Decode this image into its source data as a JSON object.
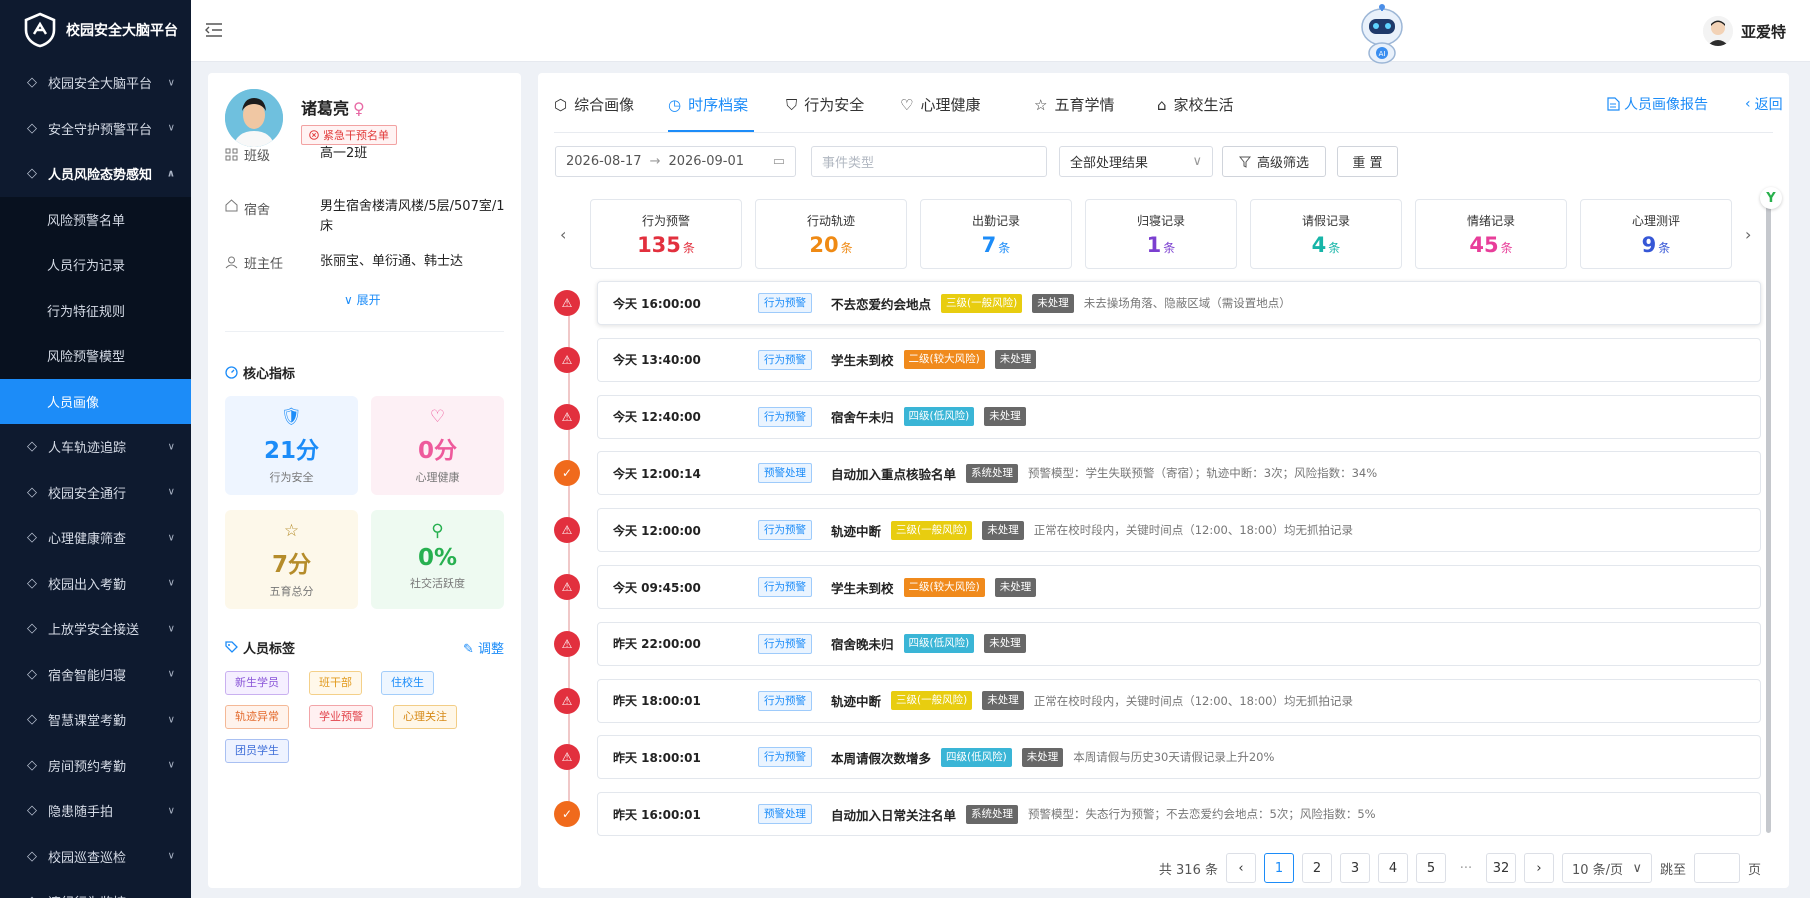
{
  "app": {
    "title": "校园安全大脑平台"
  },
  "sidebar": {
    "items": [
      {
        "label": "校园安全大脑平台",
        "icon": "shield-star-icon"
      },
      {
        "label": "安全守护预警平台",
        "icon": "alarm-icon"
      },
      {
        "label": "人员风险态势感知",
        "icon": "shield-check-icon",
        "open": true,
        "children": [
          {
            "label": "风险预警名单"
          },
          {
            "label": "人员行为记录"
          },
          {
            "label": "行为特征规则"
          },
          {
            "label": "风险预警模型"
          },
          {
            "label": "人员画像",
            "active": true
          }
        ]
      },
      {
        "label": "人车轨迹追踪",
        "icon": "location-icon"
      },
      {
        "label": "校园安全通行",
        "icon": "gate-icon"
      },
      {
        "label": "心理健康筛查",
        "icon": "heart-icon"
      },
      {
        "label": "校园出入考勤",
        "icon": "clipboard-icon"
      },
      {
        "label": "上放学安全接送",
        "icon": "users-icon"
      },
      {
        "label": "宿舍智能归寝",
        "icon": "building-icon"
      },
      {
        "label": "智慧课堂考勤",
        "icon": "classroom-icon"
      },
      {
        "label": "房间预约考勤",
        "icon": "calendar-icon"
      },
      {
        "label": "隐患随手拍",
        "icon": "camera-icon"
      },
      {
        "label": "校园巡查巡检",
        "icon": "patrol-icon"
      },
      {
        "label": "违纪行为监控",
        "icon": "monitor-icon"
      }
    ]
  },
  "header": {
    "user_name": "亚爱特"
  },
  "profile": {
    "name": "诸葛亮",
    "gender_symbol": "♀",
    "tag": "紧急干预名单",
    "class_label": "班级",
    "class_value": "高一2班",
    "dorm_label": "宿舍",
    "dorm_value": "男生宿舍楼清风楼/5层/507室/1床",
    "teacher_label": "班主任",
    "teacher_value": "张丽宝、单衍通、韩士达",
    "expand": "展开",
    "metrics_title": "核心指标",
    "metrics": [
      {
        "value": "21分",
        "label": "行为安全",
        "color": "#1c8cf8",
        "bg": "#eef5ff"
      },
      {
        "value": "0分",
        "label": "心理健康",
        "color": "#ee5a9c",
        "bg": "#fdf0f5"
      },
      {
        "value": "7分",
        "label": "五育总分",
        "color": "#b58c2a",
        "bg": "#fdf8ea"
      },
      {
        "value": "0%",
        "label": "社交活跃度",
        "color": "#27b050",
        "bg": "#eefaf1"
      }
    ],
    "tags_title": "人员标签",
    "adjust": "调整",
    "tags": [
      {
        "label": "新生学员",
        "color": "#8a56d8",
        "bg": "#f5efff",
        "border": "#c9b0f0"
      },
      {
        "label": "班干部",
        "color": "#e19a1d",
        "bg": "#fff8ea",
        "border": "#f4d089"
      },
      {
        "label": "住校生",
        "color": "#1c8cf8",
        "bg": "#eef6ff",
        "border": "#a3cdfa"
      },
      {
        "label": "轨迹异常",
        "color": "#e36a2c",
        "bg": "#fff3ec",
        "border": "#f4b896"
      },
      {
        "label": "学业预警",
        "color": "#e2434b",
        "bg": "#fff0f1",
        "border": "#f2a4a8"
      },
      {
        "label": "心理关注",
        "color": "#d68a18",
        "bg": "#fff7e8",
        "border": "#f2cd86"
      },
      {
        "label": "团员学生",
        "color": "#3f6fd8",
        "bg": "#eef3ff",
        "border": "#a9c0f2"
      }
    ]
  },
  "tabs": [
    {
      "label": "综合画像",
      "icon": "radar-icon"
    },
    {
      "label": "时序档案",
      "icon": "clock-icon",
      "active": true
    },
    {
      "label": "行为安全",
      "icon": "shield-icon"
    },
    {
      "label": "心理健康",
      "icon": "heart-icon"
    },
    {
      "label": "五育学情",
      "icon": "star-icon"
    },
    {
      "label": "家校生活",
      "icon": "home-icon"
    }
  ],
  "actions": {
    "report": "人员画像报告",
    "back": "返回"
  },
  "filters": {
    "date_start": "2026-08-17",
    "date_end": "2026-09-01",
    "event_type_placeholder": "事件类型",
    "result_select": "全部处理结果",
    "advanced": "高级筛选",
    "reset": "重 置"
  },
  "stats": [
    {
      "label": "行为预警",
      "value": "135",
      "unit": "条",
      "color": "#e2303e"
    },
    {
      "label": "行动轨迹",
      "value": "20",
      "unit": "条",
      "color": "#ef8a14"
    },
    {
      "label": "出勤记录",
      "value": "7",
      "unit": "条",
      "color": "#1c8cf8"
    },
    {
      "label": "归寝记录",
      "value": "1",
      "unit": "条",
      "color": "#7b3fd0"
    },
    {
      "label": "请假记录",
      "value": "4",
      "unit": "条",
      "color": "#17b5a8"
    },
    {
      "label": "情绪记录",
      "value": "45",
      "unit": "条",
      "color": "#e83e9a"
    },
    {
      "label": "心理测评",
      "value": "9",
      "unit": "条",
      "color": "#3657d6"
    }
  ],
  "events": [
    {
      "time": "今天 16:00:00",
      "type": "行为预警",
      "title": "不去恋爱约会地点",
      "level": "三级(一般风险)",
      "level_color": "#e8cd10",
      "status": "未处理",
      "desc": "未去操场角落、隐蔽区域（需设置地点）",
      "kind": "warn"
    },
    {
      "time": "今天 13:40:00",
      "type": "行为预警",
      "title": "学生未到校",
      "level": "二级(较大风险)",
      "level_color": "#f08a1c",
      "status": "未处理",
      "desc": "",
      "kind": "warn"
    },
    {
      "time": "今天 12:40:00",
      "type": "行为预警",
      "title": "宿舍午未归",
      "level": "四级(低风险)",
      "level_color": "#3ab5d6",
      "status": "未处理",
      "desc": "",
      "kind": "warn"
    },
    {
      "time": "今天 12:00:14",
      "type": "预警处理",
      "title": "自动加入重点核验名单",
      "level": "",
      "level_color": "",
      "status": "系统处理",
      "desc": "预警模型：学生失联预警（寄宿）；轨迹中断：3次；风险指数：34%",
      "kind": "handle"
    },
    {
      "time": "今天 12:00:00",
      "type": "行为预警",
      "title": "轨迹中断",
      "level": "三级(一般风险)",
      "level_color": "#e8cd10",
      "status": "未处理",
      "desc": "正常在校时段内，关键时间点（12:00、18:00）均无抓拍记录",
      "kind": "warn"
    },
    {
      "time": "今天 09:45:00",
      "type": "行为预警",
      "title": "学生未到校",
      "level": "二级(较大风险)",
      "level_color": "#f08a1c",
      "status": "未处理",
      "desc": "",
      "kind": "warn"
    },
    {
      "time": "昨天 22:00:00",
      "type": "行为预警",
      "title": "宿舍晚未归",
      "level": "四级(低风险)",
      "level_color": "#3ab5d6",
      "status": "未处理",
      "desc": "",
      "kind": "warn"
    },
    {
      "time": "昨天 18:00:01",
      "type": "行为预警",
      "title": "轨迹中断",
      "level": "三级(一般风险)",
      "level_color": "#e8cd10",
      "status": "未处理",
      "desc": "正常在校时段内，关键时间点（12:00、18:00）均无抓拍记录",
      "kind": "warn"
    },
    {
      "time": "昨天 18:00:01",
      "type": "行为预警",
      "title": "本周请假次数增多",
      "level": "四级(低风险)",
      "level_color": "#3ab5d6",
      "status": "未处理",
      "desc": "本周请假与历史30天请假记录上升20%",
      "kind": "warn"
    },
    {
      "time": "昨天 16:00:01",
      "type": "预警处理",
      "title": "自动加入日常关注名单",
      "level": "",
      "level_color": "",
      "status": "系统处理",
      "desc": "预警模型：失态行为预警；不去恋爱约会地点：5次；风险指数：5%",
      "kind": "handle"
    }
  ],
  "pagination": {
    "total": "共 316 条",
    "pages": [
      "1",
      "2",
      "3",
      "4",
      "5"
    ],
    "ellipsis": "···",
    "last": "32",
    "page_size": "10 条/页",
    "jump_label": "跳至",
    "jump_suffix": "页"
  },
  "colors": {
    "accent": "#1c8cf8",
    "sidebar_bg": "#0e1a2f",
    "warn": "#e2303e",
    "handle": "#f06a1c"
  }
}
